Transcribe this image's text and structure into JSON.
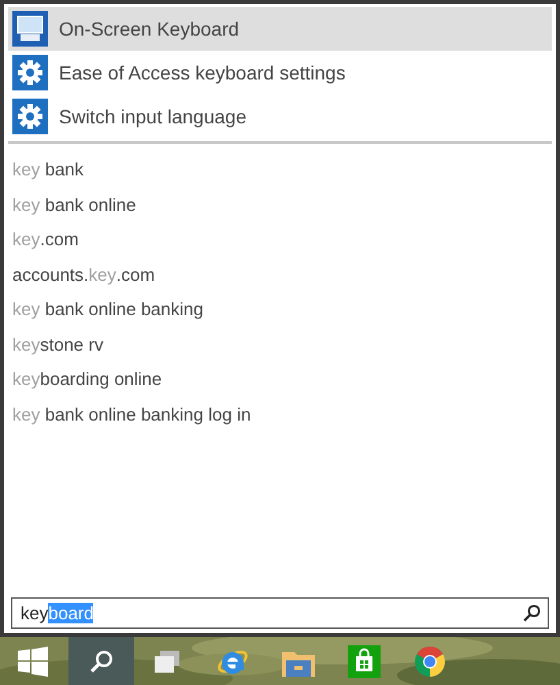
{
  "best_matches": [
    {
      "kind": "keyboard",
      "label": "On-Screen Keyboard",
      "selected": true
    },
    {
      "kind": "settings",
      "label": "Ease of Access keyboard settings",
      "selected": false
    },
    {
      "kind": "settings",
      "label": "Switch input language",
      "selected": false
    }
  ],
  "suggestions": [
    {
      "parts": [
        {
          "text": "key",
          "match": true
        },
        {
          "text": " bank",
          "match": false
        }
      ]
    },
    {
      "parts": [
        {
          "text": "key",
          "match": true
        },
        {
          "text": " bank online",
          "match": false
        }
      ]
    },
    {
      "parts": [
        {
          "text": "key",
          "match": true
        },
        {
          "text": ".com",
          "match": false
        }
      ]
    },
    {
      "parts": [
        {
          "text": "accounts.",
          "match": false
        },
        {
          "text": "key",
          "match": true
        },
        {
          "text": ".com",
          "match": false
        }
      ]
    },
    {
      "parts": [
        {
          "text": "key",
          "match": true
        },
        {
          "text": " bank online banking",
          "match": false
        }
      ]
    },
    {
      "parts": [
        {
          "text": "key",
          "match": true
        },
        {
          "text": "stone rv",
          "match": false
        }
      ]
    },
    {
      "parts": [
        {
          "text": "key",
          "match": true
        },
        {
          "text": "boarding online",
          "match": false
        }
      ]
    },
    {
      "parts": [
        {
          "text": "key",
          "match": true
        },
        {
          "text": " bank online banking log in",
          "match": false
        }
      ]
    }
  ],
  "search": {
    "parts": [
      {
        "text": "key",
        "selected": false
      },
      {
        "text": "board",
        "selected": true
      }
    ]
  },
  "taskbar": {
    "items": [
      {
        "kind": "start",
        "selected": false
      },
      {
        "kind": "search",
        "selected": true
      },
      {
        "kind": "taskview",
        "selected": false
      },
      {
        "kind": "ie",
        "selected": false
      },
      {
        "kind": "explorer",
        "selected": false
      },
      {
        "kind": "store",
        "selected": false
      },
      {
        "kind": "chrome",
        "selected": false
      }
    ]
  }
}
